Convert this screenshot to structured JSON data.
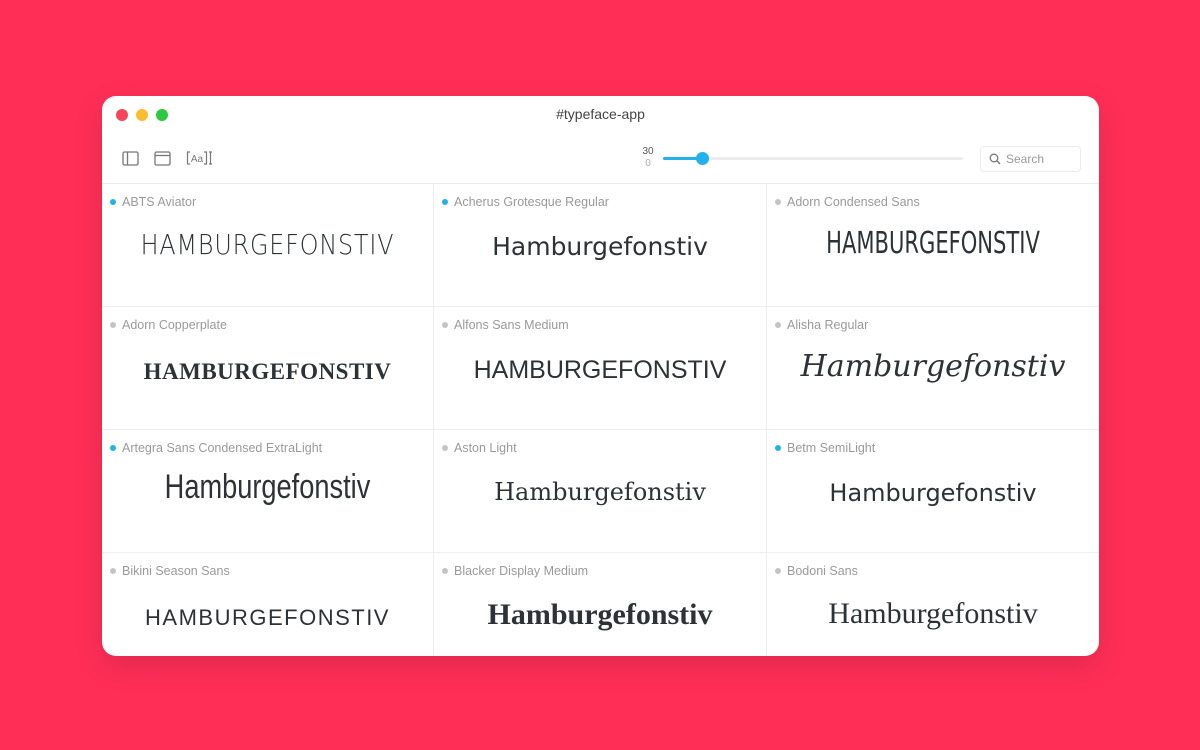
{
  "window": {
    "title": "#typeface-app",
    "traffic_lights": {
      "close": "close",
      "minimize": "minimize",
      "maximize": "maximize"
    }
  },
  "toolbar": {
    "icons": [
      "sidebar-icon",
      "window-icon",
      "text-size-icon"
    ],
    "slider": {
      "value_label": "30",
      "min_label": "0",
      "value_fraction": 0.13
    },
    "search": {
      "placeholder": "Search",
      "value": ""
    }
  },
  "colors": {
    "background": "#ff2e57",
    "accent": "#22b1ea",
    "dot_active": "#22b1ea",
    "dot_inactive": "#c4c4c4"
  },
  "sample_text": "Hamburgefonstiv",
  "fonts": [
    {
      "name": "ABTS Aviator",
      "active": true,
      "sample": "HAMBURGEFONSTIV"
    },
    {
      "name": "Acherus Grotesque Regular",
      "active": true,
      "sample": "Hamburgefonstiv"
    },
    {
      "name": "Adorn Condensed Sans",
      "active": false,
      "sample": "HAMBURGEFONSTIV"
    },
    {
      "name": "Adorn Copperplate",
      "active": false,
      "sample": "HAMBURGEFONSTIV"
    },
    {
      "name": "Alfons Sans Medium",
      "active": false,
      "sample": "HAMBURGEFONSTIV"
    },
    {
      "name": "Alisha Regular",
      "active": false,
      "sample": "Hamburgefonstiv"
    },
    {
      "name": "Artegra Sans Condensed ExtraLight",
      "active": true,
      "sample": "Hamburgefonstiv"
    },
    {
      "name": "Aston Light",
      "active": false,
      "sample": "Hamburgefonstiv"
    },
    {
      "name": "Betm SemiLight",
      "active": true,
      "sample": "Hamburgefonstiv"
    },
    {
      "name": "Bikini Season Sans",
      "active": false,
      "sample": "HAMBURGEFONSTIV"
    },
    {
      "name": "Blacker Display Medium",
      "active": false,
      "sample": "Hamburgefonstiv"
    },
    {
      "name": "Bodoni Sans",
      "active": false,
      "sample": "Hamburgefonstiv"
    }
  ]
}
